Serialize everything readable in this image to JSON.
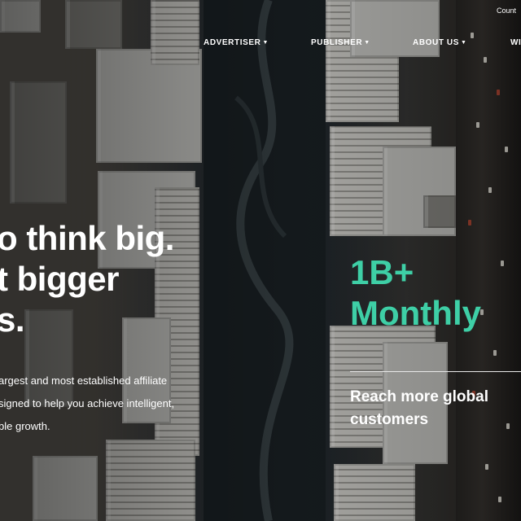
{
  "header": {
    "country_link": "Count",
    "nav": [
      {
        "label": "ADVERTISER"
      },
      {
        "label": "PUBLISHER"
      },
      {
        "label": "ABOUT US"
      },
      {
        "label": "WI"
      }
    ]
  },
  "hero": {
    "headline": [
      "o think big.",
      "t bigger",
      "s."
    ],
    "description": [
      "argest and most established affiliate",
      "signed to help you achieve intelligent,",
      "ble growth."
    ]
  },
  "stat": {
    "value": [
      "1B+",
      "Monthly"
    ],
    "caption": [
      "Reach more global",
      "customers"
    ]
  },
  "colors": {
    "accent": "#3ecfa6",
    "text": "#ffffff"
  },
  "icons": {
    "dropdown": "caret-down-icon"
  }
}
